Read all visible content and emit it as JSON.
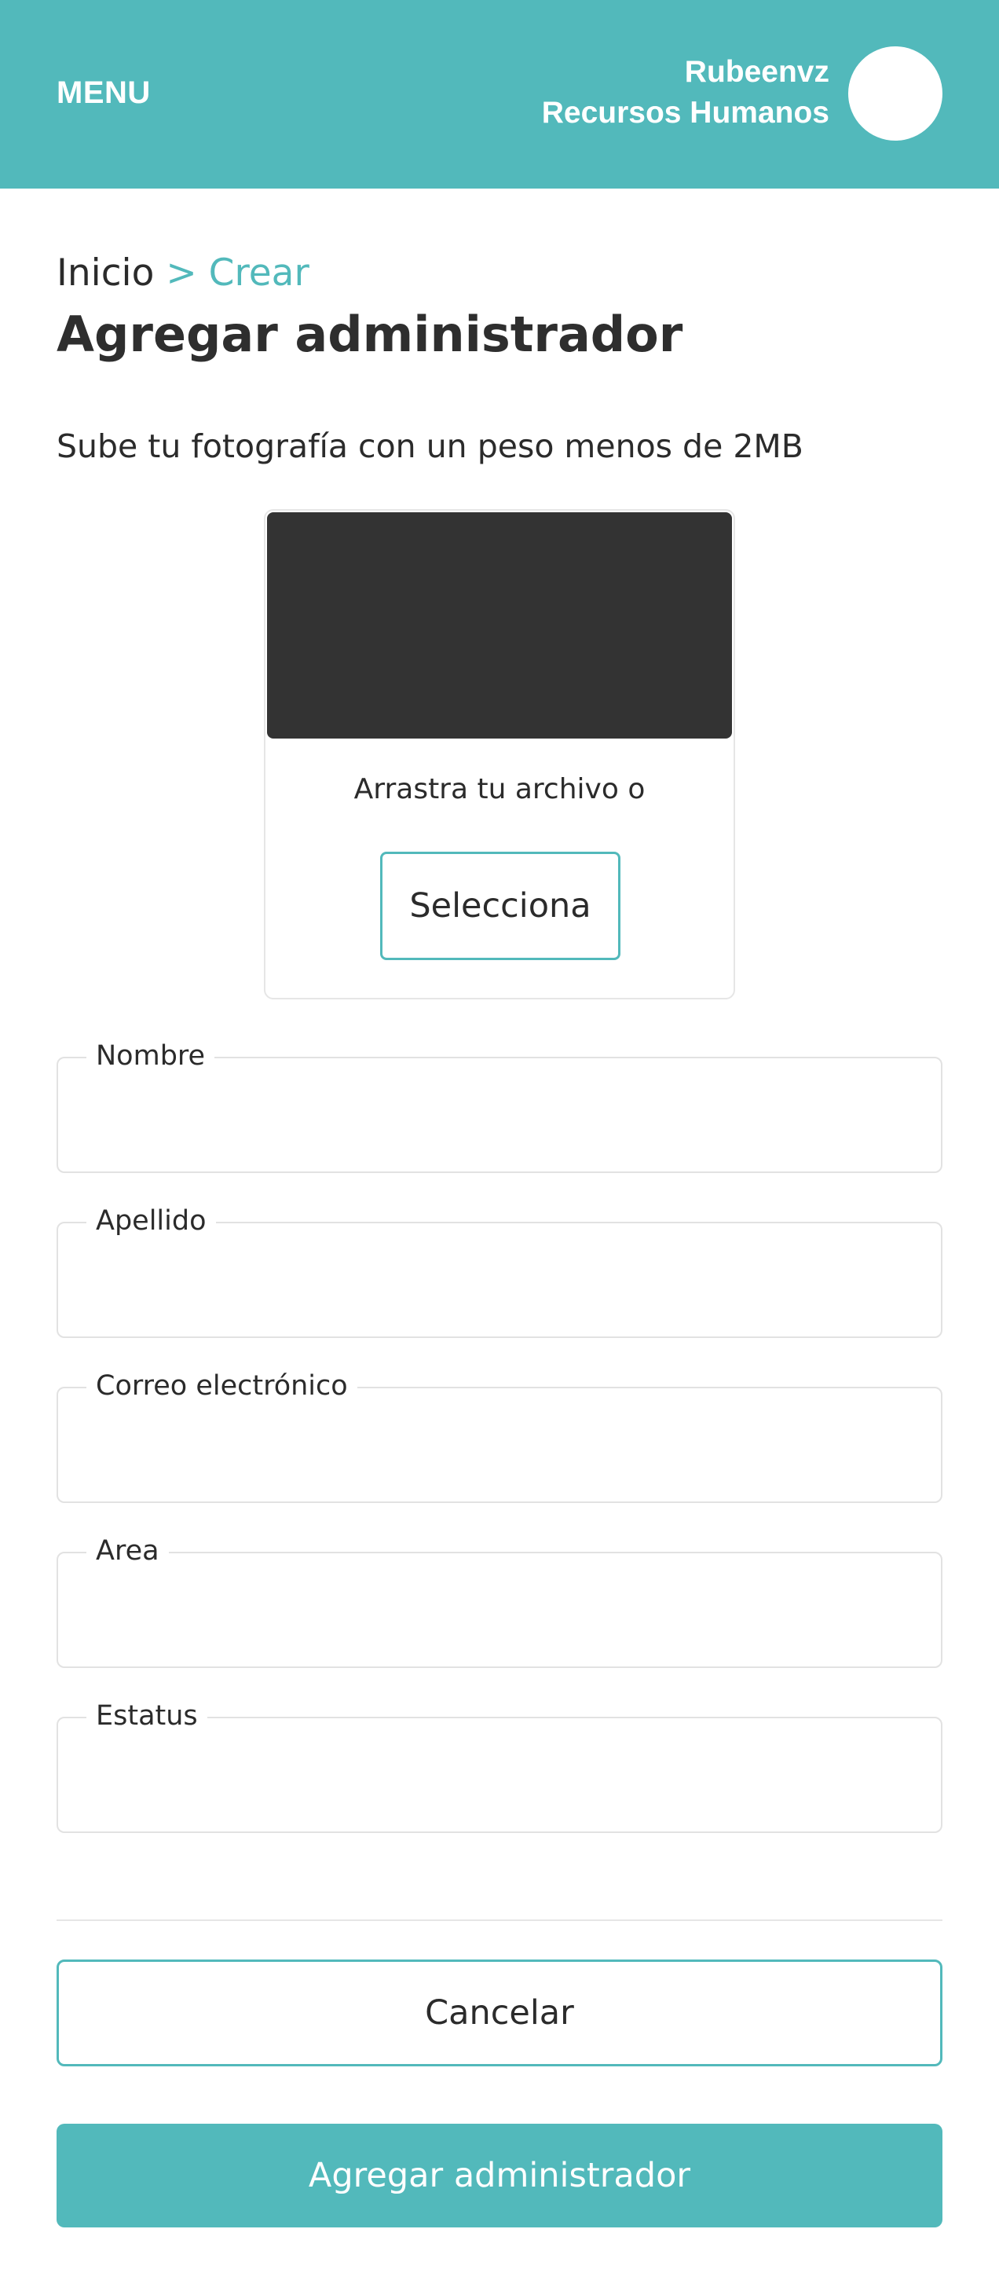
{
  "header": {
    "menu_label": "MENU",
    "user_name": "Rubeenvz",
    "user_role": "Recursos Humanos"
  },
  "breadcrumb": {
    "home": "Inicio",
    "separator_current": " > Crear"
  },
  "page_title": "Agregar administrador",
  "upload": {
    "instructions": "Sube tu fotografía con un peso menos de 2MB",
    "hint": "Arrastra tu archivo o",
    "select_label": "Selecciona"
  },
  "form": {
    "fields": [
      {
        "label": "Nombre",
        "value": ""
      },
      {
        "label": "Apellido",
        "value": ""
      },
      {
        "label": "Correo electrónico",
        "value": ""
      },
      {
        "label": "Area",
        "value": ""
      },
      {
        "label": "Estatus",
        "value": ""
      }
    ]
  },
  "actions": {
    "cancel_label": "Cancelar",
    "submit_label": "Agregar administrador"
  },
  "colors": {
    "accent": "#52b9bb",
    "preview_bg": "#333333",
    "text": "#2b2b2b"
  }
}
